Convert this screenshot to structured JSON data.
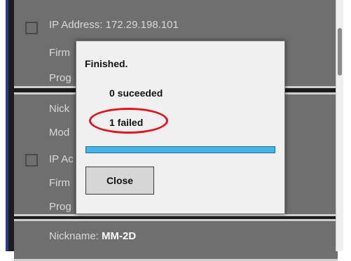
{
  "devices": [
    {
      "rows": [
        {
          "label": "IP Address: 172.29.198.101",
          "value": ""
        },
        {
          "label": "Firm",
          "value": ""
        },
        {
          "label": "Prog",
          "value": ""
        }
      ]
    },
    {
      "rows": [
        {
          "label": "Nick",
          "value": ""
        },
        {
          "label": "Mod",
          "value": ""
        },
        {
          "label": "IP Ac",
          "value": ""
        },
        {
          "label": "Firm",
          "value": ""
        },
        {
          "label": "Prog",
          "value": ""
        }
      ]
    },
    {
      "rows": [
        {
          "label": "Nickname: ",
          "value": "MM-2D"
        }
      ]
    }
  ],
  "dialog": {
    "title": "Finished.",
    "succeeded": "0 suceeded",
    "failed": "1 failed",
    "progress_fraction": 1.0,
    "close_label": "Close"
  },
  "colors": {
    "progress_fill": "#40b6ea",
    "highlight": "#e0141b",
    "card_bg": "#6f6f6f",
    "left_rail": "#2a3a86"
  }
}
